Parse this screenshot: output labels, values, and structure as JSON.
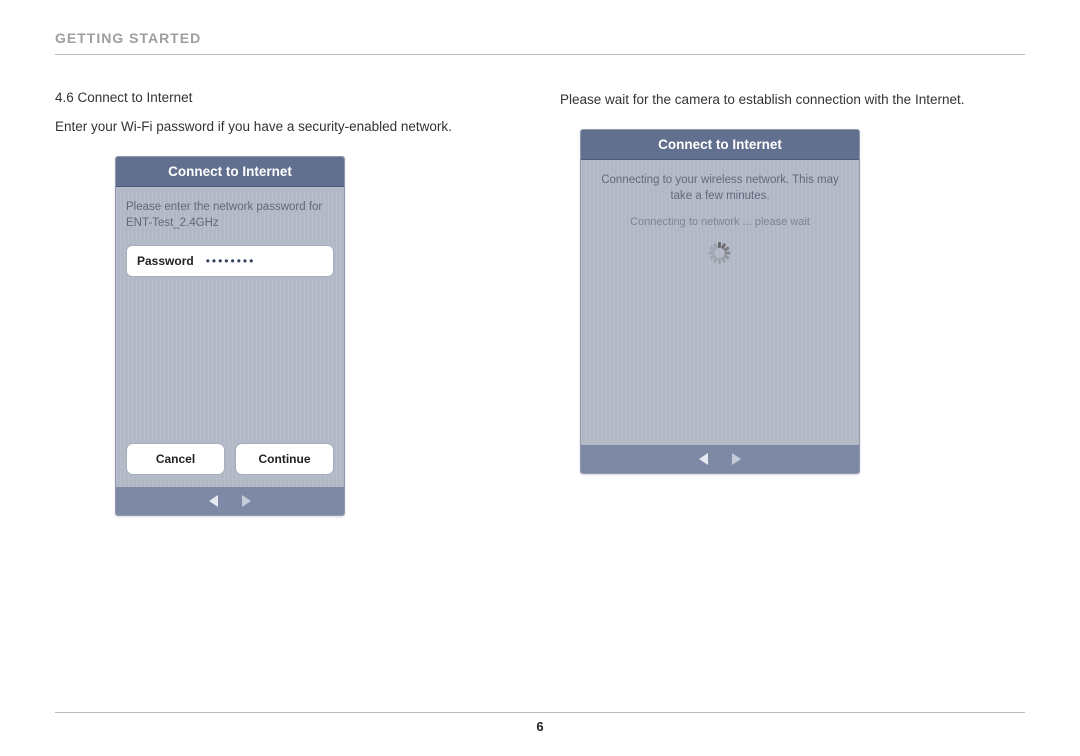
{
  "section_title": "GETTING STARTED",
  "page_number": "6",
  "left": {
    "subhead": "4.6 Connect to Internet",
    "paragraph": "Enter your Wi-Fi password if you have a security-enabled network.",
    "screen": {
      "title": "Connect to Internet",
      "prompt": "Please enter the network password for ENT-Test_2.4GHz",
      "password_label": "Password",
      "password_value": "••••••••",
      "cancel": "Cancel",
      "continue": "Continue"
    }
  },
  "right": {
    "paragraph": "Please wait for the camera to establish connection with the Internet.",
    "screen": {
      "title": "Connect to Internet",
      "line1": "Connecting to your wireless network. This may take a few minutes.",
      "line2": "Connecting to network ... please wait"
    }
  }
}
